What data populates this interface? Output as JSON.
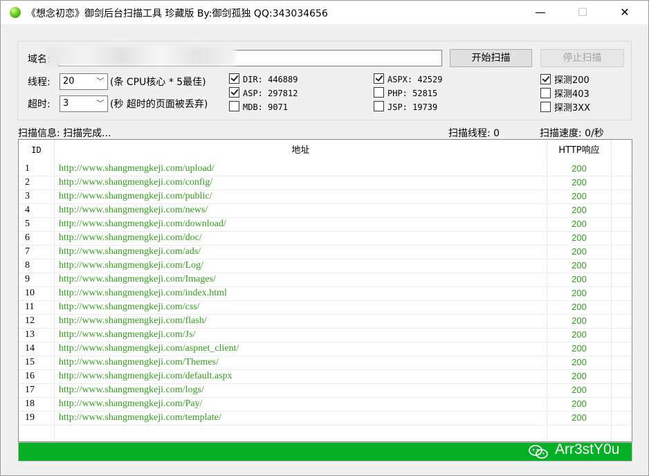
{
  "window": {
    "title": "《想念初恋》御剑后台扫描工具 珍藏版 By:御剑孤独 QQ:343034656",
    "min_glyph": "—",
    "max_glyph": "☐",
    "close_glyph": "✕"
  },
  "form": {
    "domain_label": "域名:",
    "domain_value": "",
    "threads_label": "线程:",
    "threads_value": "20",
    "threads_hint": "(条 CPU核心 * 5最佳)",
    "timeout_label": "超时:",
    "timeout_value": "3",
    "timeout_hint": "(秒 超时的页面被丢弃)",
    "start_button": "开始扫描",
    "stop_button": "停止扫描"
  },
  "dictionaries": [
    {
      "label": "DIR: 446889",
      "checked": true
    },
    {
      "label": "ASP: 297812",
      "checked": true
    },
    {
      "label": "MDB: 9071",
      "checked": false
    },
    {
      "label": "ASPX: 42529",
      "checked": true
    },
    {
      "label": "PHP: 52815",
      "checked": false
    },
    {
      "label": "JSP: 19739",
      "checked": false
    }
  ],
  "detect": [
    {
      "label": "探测200",
      "checked": true
    },
    {
      "label": "探测403",
      "checked": false
    },
    {
      "label": "探测3XX",
      "checked": false
    }
  ],
  "status": {
    "info": "扫描信息: 扫描完成...",
    "threads": "扫描线程: 0",
    "speed": "扫描速度: 0/秒"
  },
  "table": {
    "columns": [
      "ID",
      "地址",
      "HTTP响应"
    ],
    "rows": [
      {
        "id": "1",
        "url": "http://www.shangmengkeji.com/upload/",
        "code": "200"
      },
      {
        "id": "2",
        "url": "http://www.shangmengkeji.com/config/",
        "code": "200"
      },
      {
        "id": "3",
        "url": "http://www.shangmengkeji.com/public/",
        "code": "200"
      },
      {
        "id": "4",
        "url": "http://www.shangmengkeji.com/news/",
        "code": "200"
      },
      {
        "id": "5",
        "url": "http://www.shangmengkeji.com/download/",
        "code": "200"
      },
      {
        "id": "6",
        "url": "http://www.shangmengkeji.com/doc/",
        "code": "200"
      },
      {
        "id": "7",
        "url": "http://www.shangmengkeji.com/ads/",
        "code": "200"
      },
      {
        "id": "8",
        "url": "http://www.shangmengkeji.com/Log/",
        "code": "200"
      },
      {
        "id": "9",
        "url": "http://www.shangmengkeji.com/Images/",
        "code": "200"
      },
      {
        "id": "10",
        "url": "http://www.shangmengkeji.com/index.html",
        "code": "200"
      },
      {
        "id": "11",
        "url": "http://www.shangmengkeji.com/css/",
        "code": "200"
      },
      {
        "id": "12",
        "url": "http://www.shangmengkeji.com/flash/",
        "code": "200"
      },
      {
        "id": "13",
        "url": "http://www.shangmengkeji.com/Js/",
        "code": "200"
      },
      {
        "id": "14",
        "url": "http://www.shangmengkeji.com/aspnet_client/",
        "code": "200"
      },
      {
        "id": "15",
        "url": "http://www.shangmengkeji.com/Themes/",
        "code": "200"
      },
      {
        "id": "16",
        "url": "http://www.shangmengkeji.com/default.aspx",
        "code": "200"
      },
      {
        "id": "17",
        "url": "http://www.shangmengkeji.com/logs/",
        "code": "200"
      },
      {
        "id": "18",
        "url": "http://www.shangmengkeji.com/Pay/",
        "code": "200"
      },
      {
        "id": "19",
        "url": "http://www.shangmengkeji.com/template/",
        "code": "200"
      }
    ]
  },
  "progress": {
    "fraction": 1.0,
    "color": "#06b025"
  },
  "watermark": {
    "text": "Arr3stY0u",
    "icon": "wechat-icon"
  },
  "colors": {
    "url_green": "#2e9e19"
  }
}
